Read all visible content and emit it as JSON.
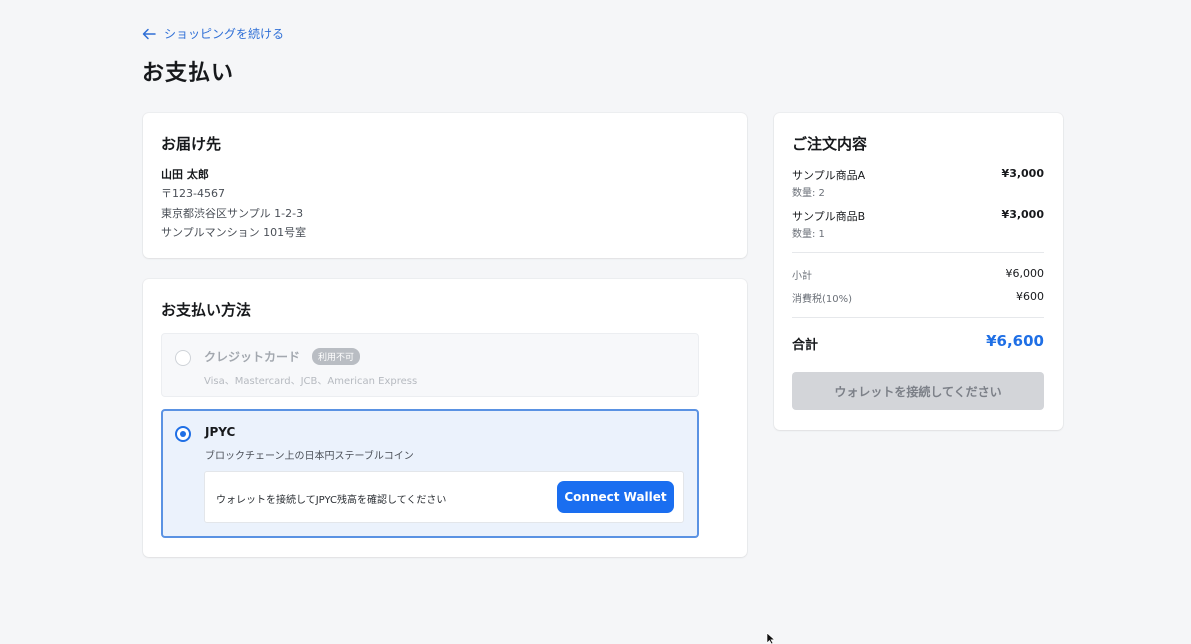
{
  "back_link": {
    "label": "ショッピングを続ける"
  },
  "page_title": "お支払い",
  "shipping": {
    "title": "お届け先",
    "name": "山田 太郎",
    "postal": "〒123-4567",
    "address_line1": "東京都渋谷区サンプル 1-2-3",
    "address_line2": "サンプルマンション 101号室"
  },
  "payment": {
    "title": "お支払い方法",
    "options": [
      {
        "name": "クレジットカード",
        "badge": "利用不可",
        "description": "Visa、Mastercard、JCB、American Express",
        "selected": false,
        "disabled": true
      },
      {
        "name": "JPYC",
        "description": "ブロックチェーン上の日本円ステーブルコイン",
        "selected": true,
        "wallet_message": "ウォレットを接続してJPYC残高を確認してください",
        "connect_label": "Connect Wallet"
      }
    ]
  },
  "order": {
    "title": "ご注文内容",
    "items": [
      {
        "name": "サンプル商品A",
        "qty": "数量: 2",
        "price": "¥3,000"
      },
      {
        "name": "サンプル商品B",
        "qty": "数量: 1",
        "price": "¥3,000"
      }
    ],
    "subtotal_label": "小計",
    "subtotal": "¥6,000",
    "tax_label": "消費税(10%)",
    "tax": "¥600",
    "total_label": "合計",
    "total": "¥6,600",
    "checkout_label": "ウォレットを接続してください"
  },
  "colors": {
    "accent": "#1f6fe5",
    "link": "#2f6fd6",
    "background": "#f5f6f8",
    "disabled_button": "#d3d5d9"
  }
}
